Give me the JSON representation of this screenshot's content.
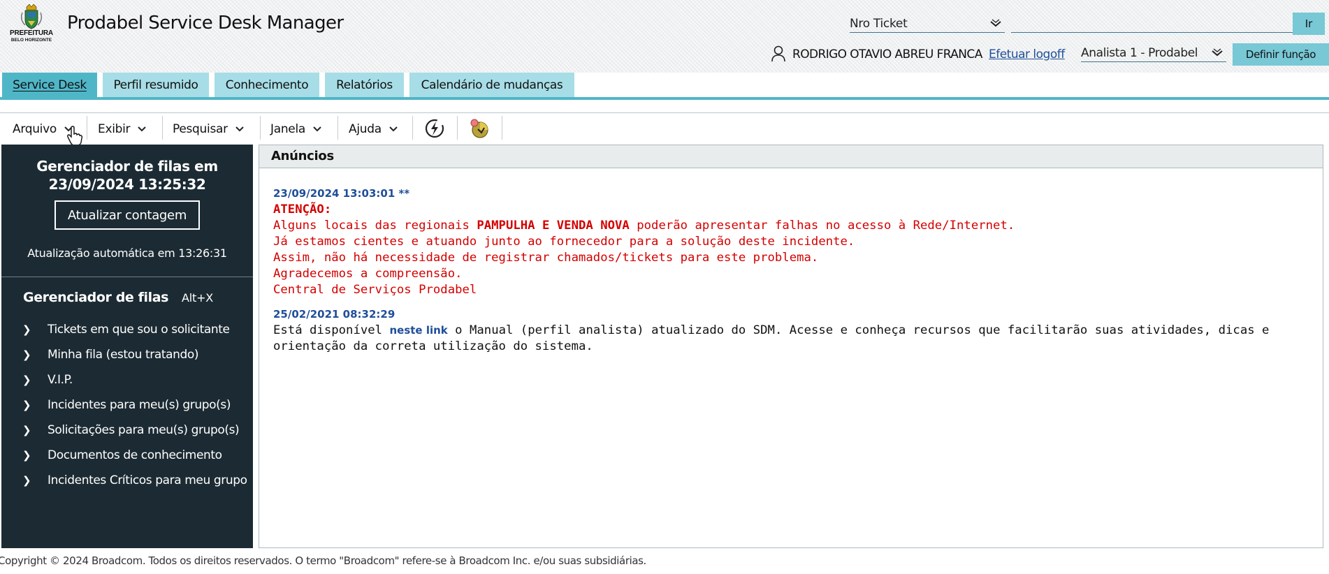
{
  "header": {
    "logo_line1": "PREFEITURA",
    "logo_line2": "BELO HORIZONTE",
    "app_title": "Prodabel Service Desk Manager",
    "ticket_search": {
      "selected": "Nro Ticket",
      "value": "",
      "go_label": "Ir"
    },
    "user_name": "RODRIGO OTAVIO ABREU FRANCA",
    "logoff_label": "Efetuar logoff",
    "role_selected": "Analista 1 - Prodabel",
    "define_role_label": "Definir função"
  },
  "tabs": [
    {
      "label": "Service Desk",
      "active": true
    },
    {
      "label": "Perfil resumido",
      "active": false
    },
    {
      "label": "Conhecimento",
      "active": false
    },
    {
      "label": "Relatórios",
      "active": false
    },
    {
      "label": "Calendário de mudanças",
      "active": false
    }
  ],
  "menu": {
    "items": [
      "Arquivo",
      "Exibir",
      "Pesquisar",
      "Janela",
      "Ajuda"
    ],
    "icons": [
      "quick-action-icon",
      "announcement-icon"
    ]
  },
  "sidebar": {
    "title_line1": "Gerenciador de filas em",
    "title_line2": "23/09/2024 13:25:32",
    "refresh_label": "Atualizar contagem",
    "auto_update": "Atualização automática em 13:26:31",
    "queue_manager_label": "Gerenciador de filas",
    "queue_manager_shortcut": "Alt+X",
    "items": [
      "Tickets em que sou o solicitante",
      "Minha fila (estou tratando)",
      "V.I.P.",
      "Incidentes para meu(s) grupo(s)",
      "Solicitações para meu(s) grupo(s)",
      "Documentos de conhecimento",
      "Incidentes Críticos para meu grupo"
    ]
  },
  "announcements": {
    "header": "Anúncios",
    "first": {
      "date": "23/09/2024 13:03:01 **",
      "attention": "ATENÇÃO:",
      "line1_pre": "Alguns locais das regionais ",
      "line1_bold": "PAMPULHA E VENDA NOVA",
      "line1_post": " poderão apresentar falhas no acesso à Rede/Internet.",
      "line2": "Já estamos cientes e atuando junto ao fornecedor para a solução deste incidente.",
      "line3": "Assim, não há necessidade de registrar chamados/tickets para este problema.",
      "line4": "Agradecemos a compreensão.",
      "line5": "Central de Serviços Prodabel"
    },
    "second": {
      "date": "25/02/2021 08:32:29",
      "text_pre": "Está disponível ",
      "link": "neste link",
      "text_post": " o Manual (perfil analista) atualizado do SDM. Acesse e conheça recursos que facilitarão suas atividades, dicas e orientação da correta utilização do sistema."
    }
  },
  "footer": "Copyright © 2024 Broadcom. Todos os direitos reservados. O termo \"Broadcom\" refere-se à Broadcom Inc. e/ou suas subsidiárias.",
  "colors": {
    "tab_active": "#4fb6c8",
    "tab_inactive": "#a7dde6",
    "sidebar_bg": "#1c2b33",
    "alert_red": "#d40000",
    "link_blue": "#1f4e9a"
  }
}
